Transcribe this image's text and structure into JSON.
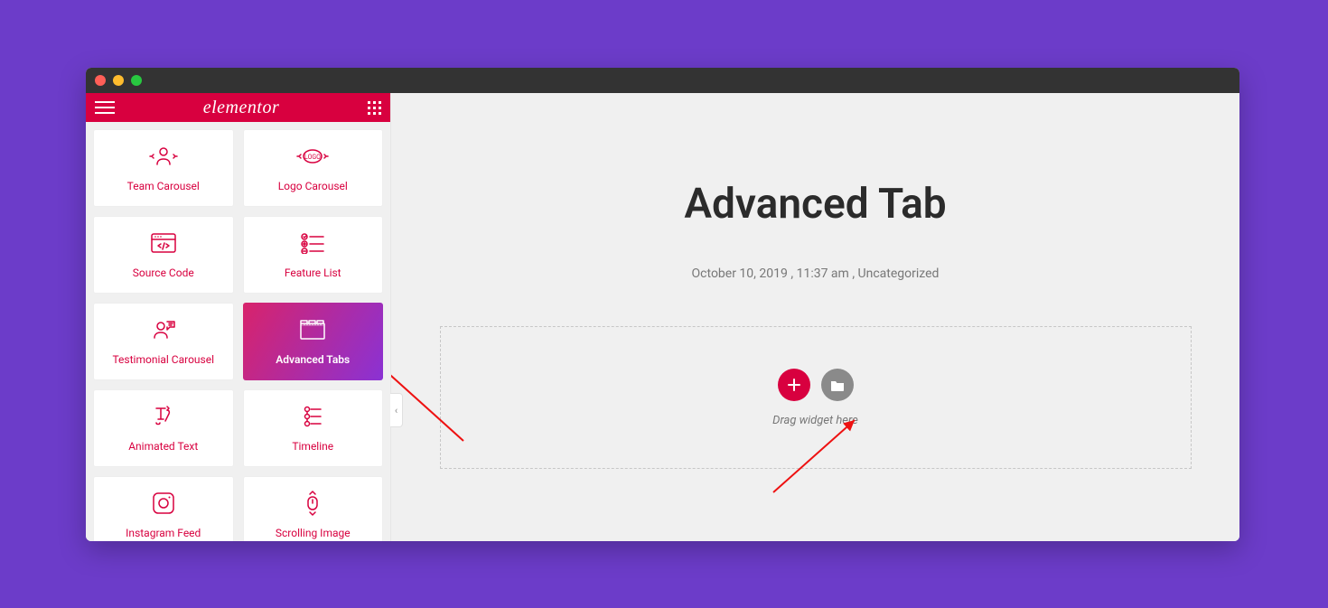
{
  "header": {
    "brand": "elementor"
  },
  "widgets": [
    {
      "name": "team-carousel",
      "label": "Team Carousel",
      "icon": "team-icon"
    },
    {
      "name": "logo-carousel",
      "label": "Logo Carousel",
      "icon": "logo-icon"
    },
    {
      "name": "source-code",
      "label": "Source Code",
      "icon": "code-icon"
    },
    {
      "name": "feature-list",
      "label": "Feature List",
      "icon": "feature-icon"
    },
    {
      "name": "testimonial-carousel",
      "label": "Testimonial Carousel",
      "icon": "testimonial-icon"
    },
    {
      "name": "advanced-tabs",
      "label": "Advanced Tabs",
      "icon": "tabs-icon",
      "active": true
    },
    {
      "name": "animated-text",
      "label": "Animated Text",
      "icon": "animtext-icon"
    },
    {
      "name": "timeline",
      "label": "Timeline",
      "icon": "timeline-icon"
    },
    {
      "name": "instagram-feed",
      "label": "Instagram Feed",
      "icon": "instagram-icon"
    },
    {
      "name": "scrolling-image",
      "label": "Scrolling Image",
      "icon": "scroll-icon"
    }
  ],
  "canvas": {
    "title": "Advanced Tab",
    "meta": {
      "date": "October 10, 2019",
      "time": "11:37 am",
      "category": "Uncategorized"
    },
    "dropzone_hint": "Drag widget here"
  }
}
